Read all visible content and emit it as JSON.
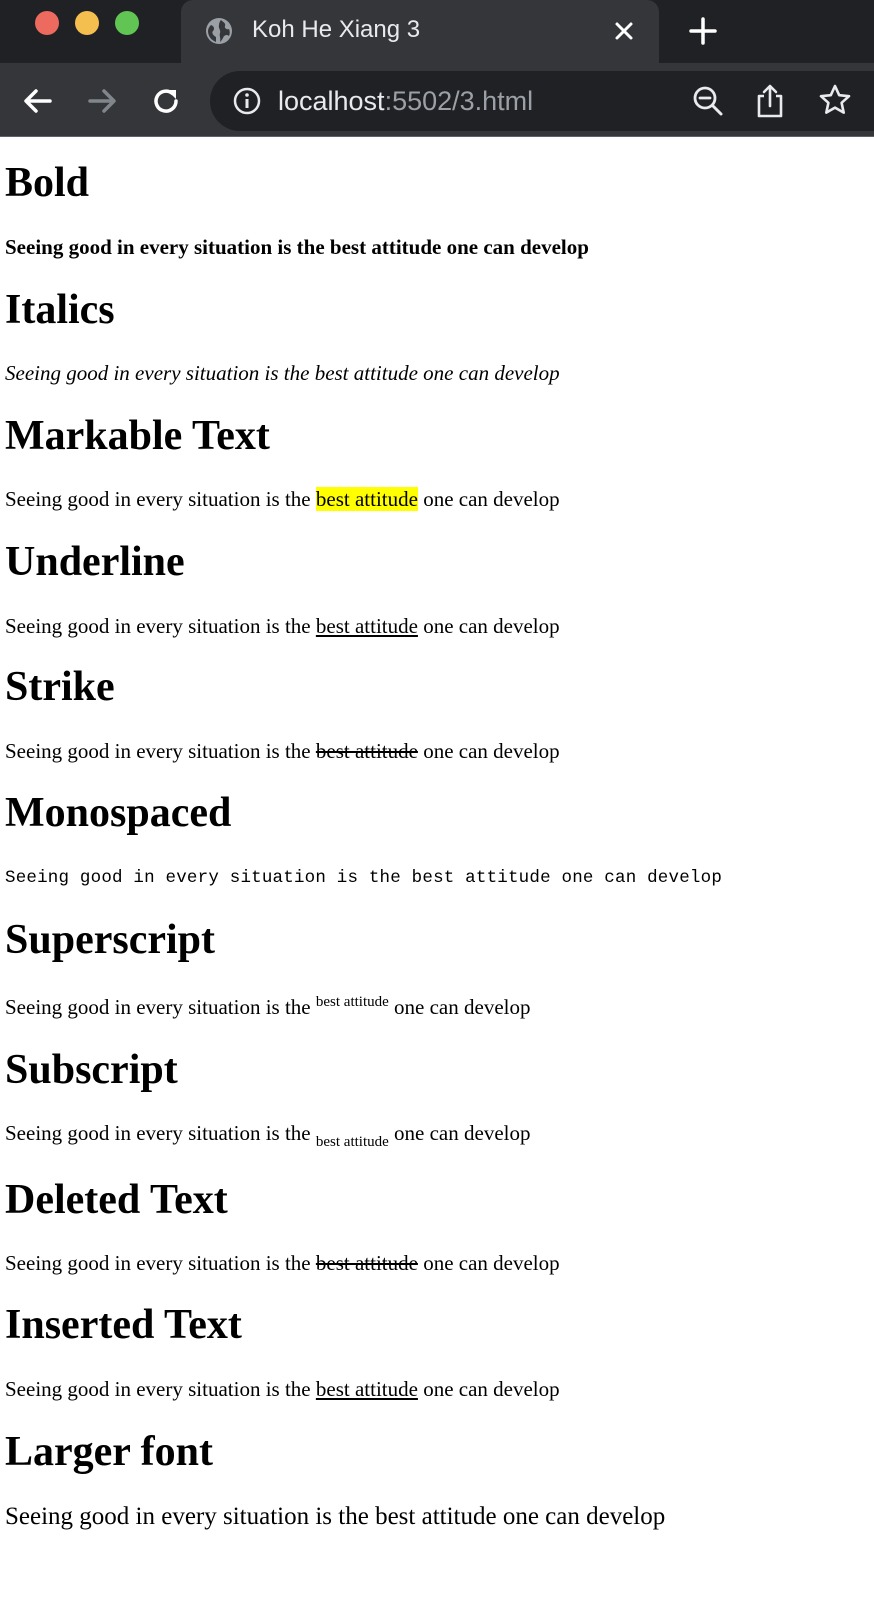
{
  "browser": {
    "tab_title": "Koh He Xiang 3",
    "url_host": "localhost",
    "url_rest": ":5502/3.html",
    "icons": {
      "tab_favicon": "globe-icon",
      "tab_close": "close-icon",
      "new_tab": "plus-icon",
      "back": "arrow-left-icon",
      "forward": "arrow-right-icon",
      "reload": "reload-icon",
      "site_info": "info-icon",
      "zoom": "zoom-out-icon",
      "share": "share-icon",
      "bookmark": "star-icon"
    }
  },
  "sections": {
    "bold": {
      "title": "Bold",
      "text": "Seeing good in every situation is the best attitude one can develop"
    },
    "italics": {
      "title": "Italics",
      "text": "Seeing good in every situation is the best attitude one can develop"
    },
    "markable": {
      "title": "Markable Text",
      "before": "Seeing good in every situation is the ",
      "marked": "best attitude",
      "after": " one can develop"
    },
    "underline": {
      "title": "Underline",
      "before": "Seeing good in every situation is the ",
      "underlined": "best attitude",
      "after": " one can develop"
    },
    "strike": {
      "title": "Strike",
      "before": "Seeing good in every situation is the ",
      "struck": "best attitude",
      "after": " one can develop"
    },
    "monospaced": {
      "title": "Monospaced",
      "text": "Seeing good in every situation is the best attitude one can develop"
    },
    "superscript": {
      "title": "Superscript",
      "before": "Seeing good in every situation is the ",
      "sup": "best attitude",
      "after": " one can develop"
    },
    "subscript": {
      "title": "Subscript",
      "before": "Seeing good in every situation is the ",
      "sub": "best attitude",
      "after": " one can develop"
    },
    "deleted": {
      "title": "Deleted Text",
      "before": "Seeing good in every situation is the ",
      "deleted": "best attitude",
      "after": " one can develop"
    },
    "inserted": {
      "title": "Inserted Text",
      "before": "Seeing good in every situation is the ",
      "inserted": "best attitude",
      "after": " one can develop"
    },
    "larger": {
      "title": "Larger font",
      "text": "Seeing good in every situation is the best attitude one can develop"
    }
  },
  "colors": {
    "highlight": "#ffff00",
    "tabbar": "#202124",
    "toolbar": "#35363a"
  }
}
